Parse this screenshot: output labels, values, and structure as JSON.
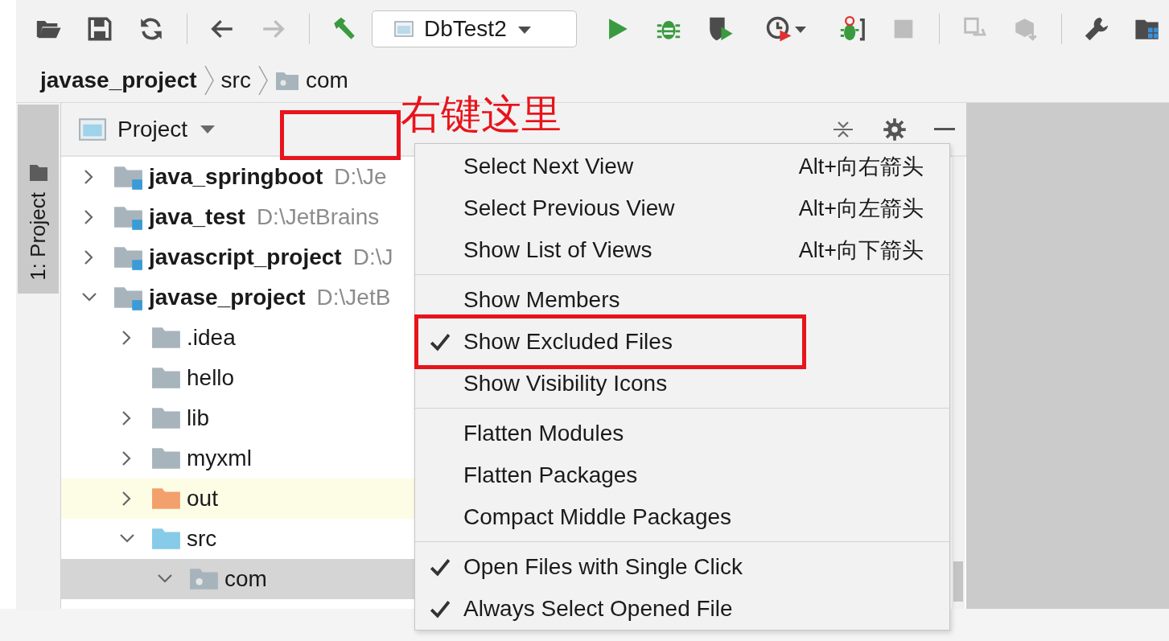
{
  "toolbar": {
    "items": [
      {
        "kind": "open",
        "disabled": false
      },
      {
        "kind": "save",
        "disabled": false
      },
      {
        "kind": "sync",
        "disabled": false
      },
      {
        "kind": "separator"
      },
      {
        "kind": "back",
        "disabled": false
      },
      {
        "kind": "forward",
        "disabled": true
      },
      {
        "kind": "separator"
      },
      {
        "kind": "build",
        "disabled": false
      },
      {
        "kind": "run-config",
        "label": "DbTest2"
      },
      {
        "kind": "run",
        "disabled": false
      },
      {
        "kind": "debug",
        "disabled": false
      },
      {
        "kind": "coverage",
        "disabled": false
      },
      {
        "kind": "profile",
        "disabled": false
      },
      {
        "kind": "attach",
        "disabled": false
      },
      {
        "kind": "stop",
        "disabled": true
      },
      {
        "kind": "separator"
      },
      {
        "kind": "vcs-update",
        "disabled": true
      },
      {
        "kind": "vcs-commit",
        "disabled": true
      },
      {
        "kind": "separator"
      },
      {
        "kind": "settings",
        "disabled": false
      },
      {
        "kind": "structure",
        "disabled": false
      }
    ]
  },
  "breadcrumbs": [
    {
      "label": "javase_project",
      "kind": "project"
    },
    {
      "label": "src",
      "kind": "folder"
    },
    {
      "label": "com",
      "kind": "package"
    }
  ],
  "tool_window_stripe": {
    "tab": {
      "label": "1: Project",
      "selected": true
    }
  },
  "project_panel": {
    "view": "Project",
    "tree": [
      {
        "label": "java_springboot",
        "path": "D:\\Je",
        "kind": "module",
        "expanded": false,
        "selected": false
      },
      {
        "label": "java_test",
        "path": "D:\\JetBrains",
        "kind": "module",
        "expanded": false,
        "selected": false
      },
      {
        "label": "javascript_project",
        "path": "D:\\J",
        "kind": "module",
        "expanded": false,
        "selected": false
      },
      {
        "label": "javase_project",
        "path": "D:\\JetB",
        "kind": "module",
        "expanded": true,
        "selected": false,
        "children": [
          {
            "label": ".idea",
            "kind": "folder",
            "expanded": false,
            "selected": false
          },
          {
            "label": "hello",
            "kind": "folder",
            "selected": false
          },
          {
            "label": "lib",
            "kind": "folder",
            "expanded": false,
            "selected": false
          },
          {
            "label": "myxml",
            "kind": "folder",
            "expanded": false,
            "selected": false
          },
          {
            "label": "out",
            "kind": "excluded",
            "expanded": false,
            "selected": false
          },
          {
            "label": "src",
            "kind": "source",
            "expanded": true,
            "selected": false,
            "children": [
              {
                "label": "com",
                "kind": "package",
                "expanded": true,
                "selected": true
              }
            ]
          }
        ]
      }
    ]
  },
  "context_menu": {
    "items": [
      {
        "kind": "item",
        "label": "Select Next View",
        "shortcut": "Alt+向右箭头",
        "checked": false,
        "annotated": false
      },
      {
        "kind": "item",
        "label": "Select Previous View",
        "shortcut": "Alt+向左箭头",
        "checked": false,
        "annotated": false
      },
      {
        "kind": "item",
        "label": "Show List of Views",
        "shortcut": "Alt+向下箭头",
        "checked": false,
        "annotated": false
      },
      {
        "kind": "separator"
      },
      {
        "kind": "item",
        "label": "Show Members",
        "checked": false,
        "annotated": false
      },
      {
        "kind": "item",
        "label": "Show Excluded Files",
        "checked": true,
        "annotated": true
      },
      {
        "kind": "item",
        "label": "Show Visibility Icons",
        "checked": false,
        "annotated": false
      },
      {
        "kind": "separator"
      },
      {
        "kind": "item",
        "label": "Flatten Modules",
        "checked": false,
        "annotated": false
      },
      {
        "kind": "item",
        "label": "Flatten Packages",
        "checked": false,
        "annotated": false
      },
      {
        "kind": "item",
        "label": "Compact Middle Packages",
        "checked": false,
        "annotated": false
      },
      {
        "kind": "separator"
      },
      {
        "kind": "item",
        "label": "Open Files with Single Click",
        "checked": true,
        "annotated": false
      },
      {
        "kind": "item",
        "label": "Always Select Opened File",
        "checked": true,
        "annotated": false
      }
    ]
  },
  "annotation": {
    "text": "右键这里"
  }
}
